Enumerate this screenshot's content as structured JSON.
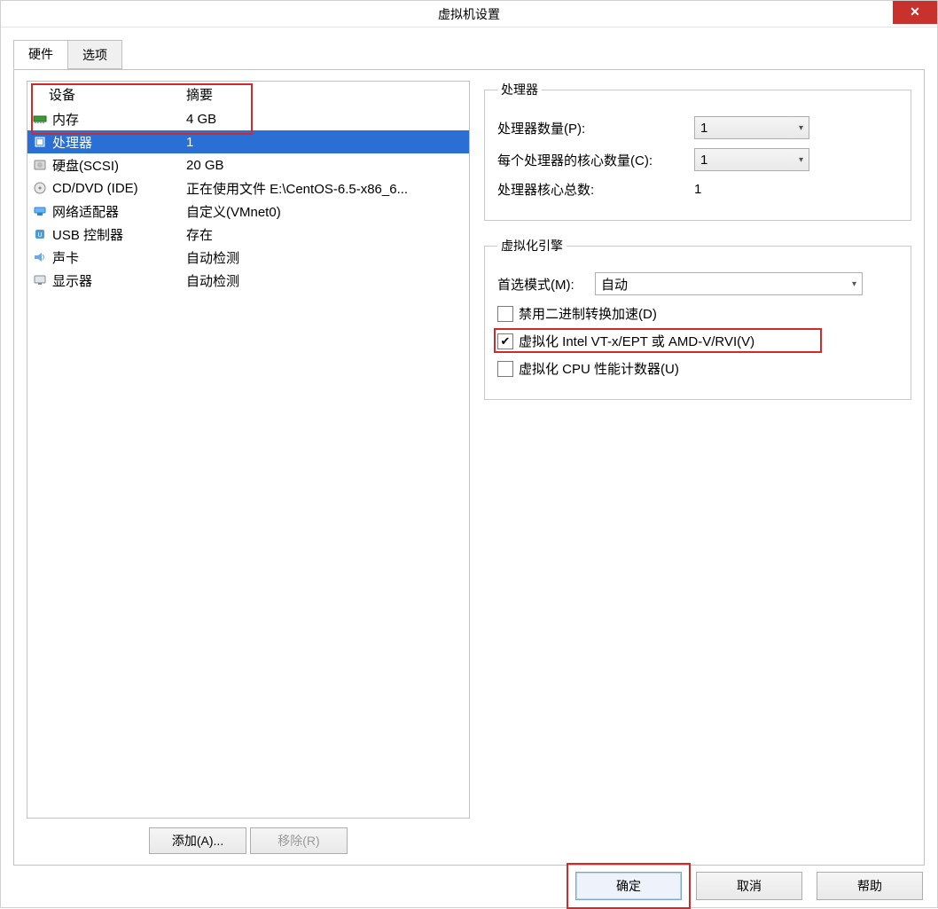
{
  "window": {
    "title": "虚拟机设置"
  },
  "tabs": {
    "hardware": "硬件",
    "options": "选项"
  },
  "device_list": {
    "header_device": "设备",
    "header_summary": "摘要",
    "rows": [
      {
        "icon": "memory-icon",
        "name": "内存",
        "summary": "4 GB"
      },
      {
        "icon": "cpu-icon",
        "name": "处理器",
        "summary": "1"
      },
      {
        "icon": "disk-icon",
        "name": "硬盘(SCSI)",
        "summary": "20 GB"
      },
      {
        "icon": "cd-icon",
        "name": "CD/DVD (IDE)",
        "summary": "正在使用文件 E:\\CentOS-6.5-x86_6..."
      },
      {
        "icon": "net-icon",
        "name": "网络适配器",
        "summary": "自定义(VMnet0)"
      },
      {
        "icon": "usb-icon",
        "name": "USB 控制器",
        "summary": "存在"
      },
      {
        "icon": "sound-icon",
        "name": "声卡",
        "summary": "自动检测"
      },
      {
        "icon": "display-icon",
        "name": "显示器",
        "summary": "自动检测"
      }
    ],
    "selected_index": 1,
    "add_btn": "添加(A)...",
    "remove_btn": "移除(R)"
  },
  "processor_group": {
    "legend": "处理器",
    "count_label": "处理器数量(P):",
    "count_value": "1",
    "cores_label": "每个处理器的核心数量(C):",
    "cores_value": "1",
    "total_label": "处理器核心总数:",
    "total_value": "1"
  },
  "virtualization_group": {
    "legend": "虚拟化引擎",
    "mode_label": "首选模式(M):",
    "mode_value": "自动",
    "chk_disable_binary": {
      "checked": false,
      "label": "禁用二进制转换加速(D)"
    },
    "chk_vt": {
      "checked": true,
      "label": "虚拟化 Intel VT-x/EPT 或 AMD-V/RVI(V)"
    },
    "chk_cpu_perf": {
      "checked": false,
      "label": "虚拟化 CPU 性能计数器(U)"
    }
  },
  "footer": {
    "ok": "确定",
    "cancel": "取消",
    "help": "帮助"
  }
}
